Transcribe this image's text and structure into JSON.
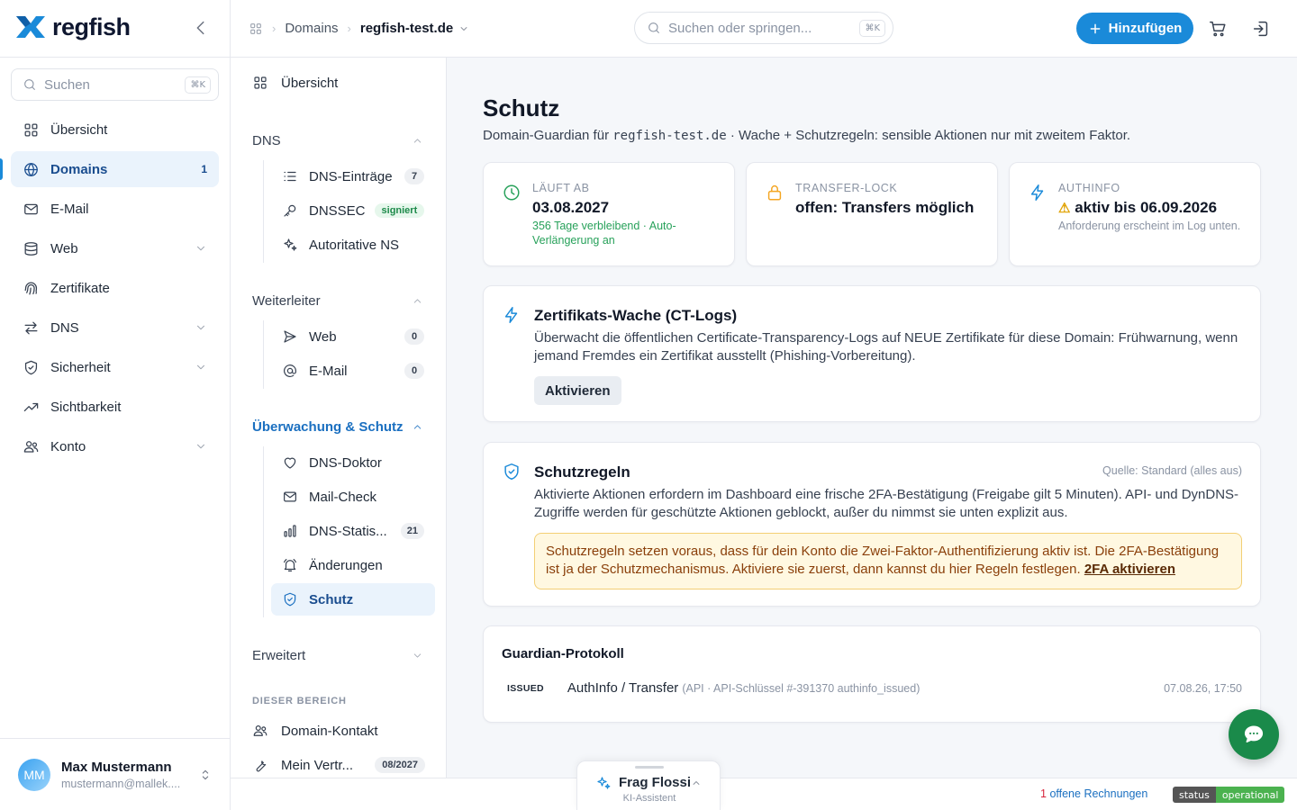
{
  "brand": {
    "name": "regfish",
    "accent": "#1a8ad9"
  },
  "sidebar": {
    "search_placeholder": "Suchen",
    "search_shortcut": "⌘K",
    "items": [
      {
        "label": "Übersicht",
        "icon": "grid-icon"
      },
      {
        "label": "Domains",
        "icon": "globe-icon",
        "badge": "1",
        "active": true
      },
      {
        "label": "E-Mail",
        "icon": "mail-icon"
      },
      {
        "label": "Web",
        "icon": "server-icon",
        "expandable": true
      },
      {
        "label": "Zertifikate",
        "icon": "fingerprint-icon"
      },
      {
        "label": "DNS",
        "icon": "arrows-icon",
        "expandable": true
      },
      {
        "label": "Sicherheit",
        "icon": "shield-icon",
        "expandable": true
      },
      {
        "label": "Sichtbarkeit",
        "icon": "trend-icon"
      },
      {
        "label": "Konto",
        "icon": "users-icon",
        "expandable": true
      }
    ],
    "user": {
      "initials": "MM",
      "name": "Max Mustermann",
      "email": "mustermann@mallek...."
    }
  },
  "header": {
    "breadcrumb_section": "Domains",
    "breadcrumb_current": "regfish-test.de",
    "search_placeholder": "Suchen oder springen...",
    "search_shortcut": "⌘K",
    "add_button": "Hinzufügen"
  },
  "subnav": {
    "overview": "Übersicht",
    "sections": {
      "dns": "DNS",
      "weiterleiter": "Weiterleiter",
      "monitoring": "Überwachung & Schutz",
      "advanced": "Erweitert"
    },
    "dns_items": [
      {
        "label": "DNS-Einträge",
        "count": "7"
      },
      {
        "label": "DNSSEC",
        "tag": "signiert"
      },
      {
        "label": "Autoritative NS"
      }
    ],
    "forward_items": [
      {
        "label": "Web",
        "count": "0"
      },
      {
        "label": "E-Mail",
        "count": "0"
      }
    ],
    "monitor_items": [
      {
        "label": "DNS-Doktor"
      },
      {
        "label": "Mail-Check"
      },
      {
        "label": "DNS-Statis...",
        "count": "21"
      },
      {
        "label": "Änderungen"
      },
      {
        "label": "Schutz",
        "active": true
      }
    ],
    "zone_label": "DIESER BEREICH",
    "bottom_items": [
      {
        "label": "Domain-Kontakt"
      },
      {
        "label": "Mein Vertr...",
        "count": "08/2027"
      }
    ]
  },
  "main": {
    "title": "Schutz",
    "subtitle_prefix": "Domain-Guardian für",
    "subtitle_domain": "regfish-test.de",
    "subtitle_suffix": "· Wache + Schutzregeln: sensible Aktionen nur mit zweitem Faktor.",
    "stats": [
      {
        "label": "LÄUFT AB",
        "value": "03.08.2027",
        "note": "356 Tage verbleibend · Auto-Verlängerung an",
        "color": "#27a15a"
      },
      {
        "label": "TRANSFER-LOCK",
        "value": "offen: Transfers möglich",
        "note": "",
        "color": "#f4a623"
      },
      {
        "label": "AUTHINFO",
        "value": "aktiv bis 06.09.2026",
        "warn_symbol": "⚠",
        "note": "Anforderung erscheint im Log unten.",
        "color": "#1a8ad9"
      }
    ],
    "ct_watch": {
      "title": "Zertifikats-Wache (CT-Logs)",
      "text": "Überwacht die öffentlichen Certificate-Transparency-Logs auf NEUE Zertifikate für diese Domain: Frühwarnung, wenn jemand Fremdes ein Zertifikat ausstellt (Phishing-Vorbereitung).",
      "button": "Aktivieren"
    },
    "rules": {
      "title": "Schutzregeln",
      "source": "Quelle: Standard (alles aus)",
      "text": "Aktivierte Aktionen erfordern im Dashboard eine frische 2FA-Bestätigung (Freigabe gilt 5 Minuten). API- und DynDNS-Zugriffe werden für geschützte Aktionen geblockt, außer du nimmst sie unten explizit aus.",
      "warning": "Schutzregeln setzen voraus, dass für dein Konto die Zwei-Faktor-Authentifizierung aktiv ist. Die 2FA-Bestätigung ist ja der Schutzmechanismus. Aktiviere sie zuerst, dann kannst du hier Regeln festlegen.",
      "warning_link": "2FA aktivieren"
    },
    "log": {
      "title": "Guardian-Protokoll",
      "rows": [
        {
          "tag": "ISSUED",
          "action": "AuthInfo / Transfer",
          "meta": "(API · API-Schlüssel #-391370 authinfo_issued)",
          "time": "07.08.26, 17:50"
        }
      ]
    }
  },
  "footer": {
    "invoice_count": "1",
    "invoice_text": "offene Rechnungen",
    "status_key": "status",
    "status_value": "operational"
  },
  "assistant": {
    "title": "Frag Flossi",
    "subtitle": "KI-Assistent"
  }
}
